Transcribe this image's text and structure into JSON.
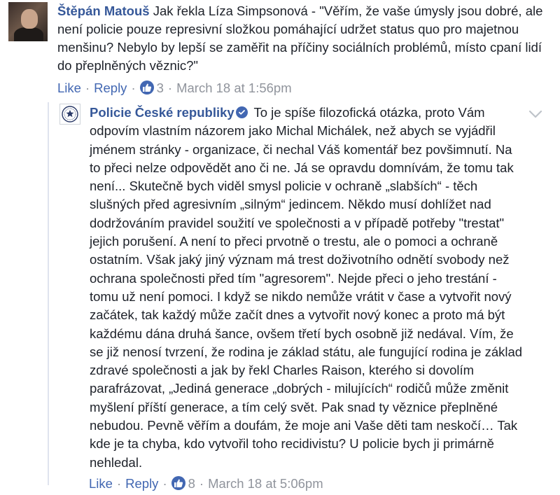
{
  "comment1": {
    "author": "Štěpán Matouš",
    "text": "Jak řekla Líza Simpsonová - \"Věřím, že vaše úmysly jsou dobré, ale není policie pouze represivní složkou pomáhající udržet status quo pro majetnou menšinu? Nebylo by lepší se zaměřit na příčiny sociálních problémů, místo cpaní lidí do přeplněných věznic?\"",
    "like_label": "Like",
    "reply_label": "Reply",
    "reaction_count": "3",
    "timestamp": "March 18 at 1:56pm",
    "avatar_icon": "profile-photo"
  },
  "comment2": {
    "author": "Policie České republiky",
    "text": "To je spíše filozofická otázka, proto Vám odpovím vlastním názorem jako Michal Michálek, než abych se vyjádřil jménem stránky - organizace, či nechal Váš komentář bez povšimnutí. Na to přeci nelze odpovědět ano či ne. Já se opravdu domnívám, že tomu tak není... Skutečně bych viděl smysl policie v ochraně „slabších“ - těch slušných před agresivním „silným“ jedincem. Někdo musí dohlížet nad dodržováním pravidel soužití ve společnosti a v případě potřeby \"trestat\" jejich porušení. A není to přeci prvotně o trestu, ale o pomoci a ochraně ostatním. Však jaký jiný význam má trest doživotního odnětí svobody než ochrana společnosti před tím \"agresorem\". Nejde přeci o jeho trestání - tomu už není pomoci. I když se nikdo nemůže vrátit v čase a vytvořit nový začátek, tak každý může začít dnes a vytvořit nový konec a proto má být každému dána druhá šance, ovšem třetí bych osobně již nedával. Vím, že se již nenosí tvrzení, že rodina je základ státu, ale fungující rodina je základ zdravé společnosti a jak by řekl Charles Raison, kterého si dovolím parafrázovat, „Jediná generace „dobrých - milujících“ rodičů může změnit myšlení příští generace, a tím celý svět. Pak snad ty věznice přeplněné nebudou. Pevně věřím a doufám, že moje ani Vaše děti tam neskočí… Tak kde je ta chyba, kdo vytvořil toho recidivistu? U policie bych ji primárně nehledal.",
    "like_label": "Like",
    "reply_label": "Reply",
    "reaction_count": "8",
    "timestamp": "March 18 at 5:06pm",
    "avatar_icon": "police-logo",
    "verified_icon": "verified-badge"
  },
  "colors": {
    "author": "#365899",
    "link": "#4267b2",
    "meta": "#90949c",
    "text": "#1d2129"
  }
}
